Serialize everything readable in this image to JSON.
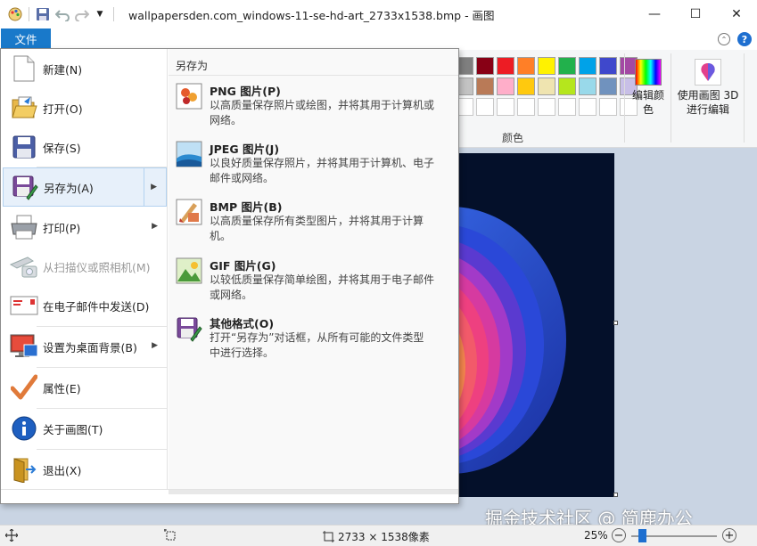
{
  "window": {
    "title": "wallpapersden.com_windows-11-se-hd-art_2733x1538.bmp - 画图",
    "minimize": "—",
    "maximize": "☐",
    "close": "✕"
  },
  "file_tab": "文件",
  "ribbon": {
    "colors_group": "颜色",
    "edit_colors_label": "编辑颜色",
    "paint3d_label": "使用画图 3D 进行编辑",
    "palette_row1": [
      "#7f7f7f",
      "#880015",
      "#ed1c24",
      "#ff7f27",
      "#fff200",
      "#22b14c",
      "#00a2e8",
      "#3f48cc",
      "#a349a4"
    ],
    "palette_row2": [
      "#c3c3c3",
      "#b97a57",
      "#ffaec9",
      "#ffc90e",
      "#efe4b0",
      "#b5e61d",
      "#99d9ea",
      "#7092be",
      "#c8bfe7"
    ]
  },
  "file_menu": {
    "items": [
      {
        "label": "新建(N)",
        "icon": "new-document-icon",
        "disabled": false
      },
      {
        "label": "打开(O)",
        "icon": "open-folder-icon",
        "disabled": false
      },
      {
        "label": "保存(S)",
        "icon": "floppy-disk-icon",
        "disabled": false
      },
      {
        "label": "另存为(A)",
        "icon": "save-as-icon",
        "disabled": false,
        "selected": true,
        "submenu": true
      },
      {
        "label": "打印(P)",
        "icon": "printer-icon",
        "disabled": false,
        "submenu": true
      },
      {
        "label": "从扫描仪或照相机(M)",
        "icon": "scanner-camera-icon",
        "disabled": true
      },
      {
        "label": "在电子邮件中发送(D)",
        "icon": "email-icon",
        "disabled": false
      },
      {
        "label": "设置为桌面背景(B)",
        "icon": "desktop-background-icon",
        "disabled": false,
        "submenu": true
      },
      {
        "label": "属性(E)",
        "icon": "checkmark-icon",
        "disabled": false
      },
      {
        "label": "关于画图(T)",
        "icon": "info-icon",
        "disabled": false
      },
      {
        "label": "退出(X)",
        "icon": "exit-icon",
        "disabled": false
      }
    ],
    "submenu_title": "另存为",
    "submenu_items": [
      {
        "name": "PNG 图片(P)",
        "desc": "以高质量保存照片或绘图，并将其用于计算机或网络。",
        "icon": "png-image-icon"
      },
      {
        "name": "JPEG 图片(J)",
        "desc": "以良好质量保存照片，并将其用于计算机、电子邮件或网络。",
        "icon": "jpeg-image-icon"
      },
      {
        "name": "BMP 图片(B)",
        "desc": "以高质量保存所有类型图片，并将其用于计算机。",
        "icon": "bmp-image-icon"
      },
      {
        "name": "GIF 图片(G)",
        "desc": "以较低质量保存简单绘图，并将其用于电子邮件或网络。",
        "icon": "gif-image-icon"
      },
      {
        "name": "其他格式(O)",
        "desc": "打开“另存为”对话框，从所有可能的文件类型中进行选择。",
        "icon": "other-formats-icon"
      }
    ]
  },
  "status": {
    "dimensions": "2733 × 1538像素",
    "zoom": "25%"
  },
  "watermark": "掘金技术社区 @ 简鹿办公"
}
